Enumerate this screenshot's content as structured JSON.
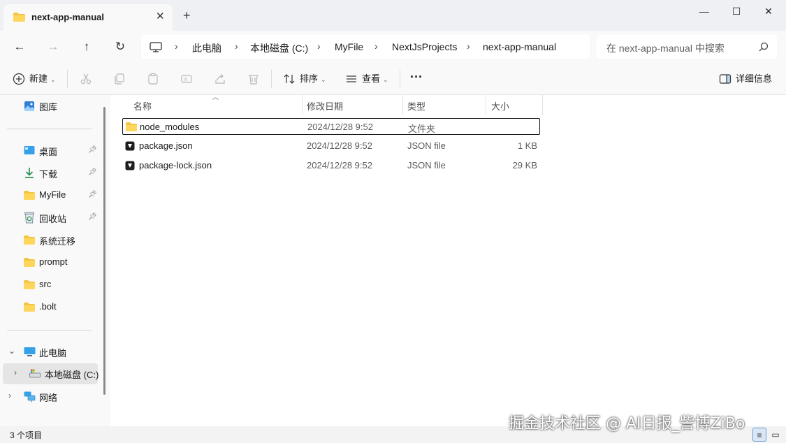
{
  "tab": {
    "title": "next-app-manual",
    "close": "✕",
    "new_tab": "+"
  },
  "window_controls": {
    "minimize": "—",
    "maximize": "☐",
    "close": "✕"
  },
  "nav": {
    "back": "←",
    "forward": "→",
    "up": "↑",
    "refresh": "↻"
  },
  "breadcrumb": {
    "items": [
      "此电脑",
      "本地磁盘 (C:)",
      "MyFile",
      "NextJsProjects",
      "next-app-manual"
    ],
    "separator": "›"
  },
  "search": {
    "placeholder": "在 next-app-manual 中搜索"
  },
  "toolbar": {
    "new_label": "新建",
    "sort_label": "排序",
    "view_label": "查看",
    "more_label": "···",
    "details_label": "详细信息"
  },
  "sidebar": {
    "top_item": {
      "label": "图库"
    },
    "pinned": [
      {
        "label": "桌面",
        "icon": "desktop-icon"
      },
      {
        "label": "下载",
        "icon": "download-icon"
      },
      {
        "label": "MyFile",
        "icon": "folder-icon"
      },
      {
        "label": "回收站",
        "icon": "recycle-bin-icon"
      }
    ],
    "folders": [
      {
        "label": "系统迁移"
      },
      {
        "label": "prompt"
      },
      {
        "label": "src"
      },
      {
        "label": ".bolt"
      }
    ],
    "this_pc": {
      "label": "此电脑"
    },
    "local_disk": {
      "label": "本地磁盘 (C:)"
    },
    "network": {
      "label": "网络"
    }
  },
  "columns": {
    "name": "名称",
    "modified": "修改日期",
    "type": "类型",
    "size": "大小"
  },
  "files": [
    {
      "name": "node_modules",
      "modified": "2024/12/28 9:52",
      "type": "文件夹",
      "size": "",
      "icon": "folder-icon"
    },
    {
      "name": "package.json",
      "modified": "2024/12/28 9:52",
      "type": "JSON file",
      "size": "1 KB",
      "icon": "json-file-icon"
    },
    {
      "name": "package-lock.json",
      "modified": "2024/12/28 9:52",
      "type": "JSON file",
      "size": "29 KB",
      "icon": "json-file-icon"
    }
  ],
  "status": {
    "item_count": "3 个项目"
  },
  "watermark": "掘金技术社区 @ AI日报_訾博ZiBo",
  "colors": {
    "folder": "#f4c542",
    "accent": "#0067c0"
  }
}
